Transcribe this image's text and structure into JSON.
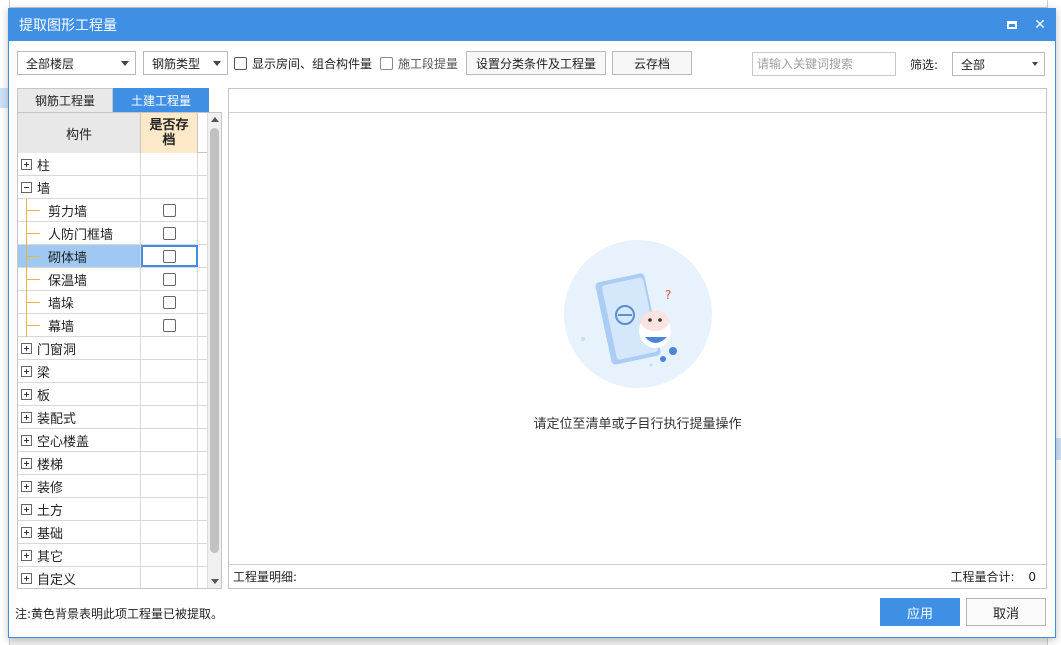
{
  "dialog": {
    "title": "提取图形工程量"
  },
  "toolbar": {
    "floor_select": "全部楼层",
    "rebar_type_select": "钢筋类型",
    "show_room_label": "显示房间、组合构件量",
    "construction_stage_label": "施工段提量",
    "settings_button": "设置分类条件及工程量",
    "cloud_archive_button": "云存档",
    "search_placeholder": "请输入关键词搜索",
    "filter_label": "筛选:",
    "filter_select": "全部"
  },
  "tabs": [
    {
      "label": "钢筋工程量",
      "active": false
    },
    {
      "label": "土建工程量",
      "active": true
    }
  ],
  "tree": {
    "header_name": "构件",
    "header_archive_1": "是否存",
    "header_archive_2": "档",
    "rows": [
      {
        "label": "柱",
        "type": "parent",
        "expanded": false
      },
      {
        "label": "墙",
        "type": "parent",
        "expanded": true
      },
      {
        "label": "剪力墙",
        "type": "child"
      },
      {
        "label": "人防门框墙",
        "type": "child"
      },
      {
        "label": "砌体墙",
        "type": "child",
        "selected": true
      },
      {
        "label": "保温墙",
        "type": "child"
      },
      {
        "label": "墙垛",
        "type": "child"
      },
      {
        "label": "幕墙",
        "type": "child"
      },
      {
        "label": "门窗洞",
        "type": "parent",
        "expanded": false
      },
      {
        "label": "梁",
        "type": "parent",
        "expanded": false
      },
      {
        "label": "板",
        "type": "parent",
        "expanded": false
      },
      {
        "label": "装配式",
        "type": "parent",
        "expanded": false
      },
      {
        "label": "空心楼盖",
        "type": "parent",
        "expanded": false
      },
      {
        "label": "楼梯",
        "type": "parent",
        "expanded": false
      },
      {
        "label": "装修",
        "type": "parent",
        "expanded": false
      },
      {
        "label": "土方",
        "type": "parent",
        "expanded": false
      },
      {
        "label": "基础",
        "type": "parent",
        "expanded": false
      },
      {
        "label": "其它",
        "type": "parent",
        "expanded": false
      },
      {
        "label": "自定义",
        "type": "parent",
        "expanded": false
      }
    ]
  },
  "main": {
    "empty_message": "请定位至清单或子目行执行提量操作",
    "footer_detail_label": "工程量明细:",
    "footer_total_label": "工程量合计:",
    "footer_total_value": "0"
  },
  "footer": {
    "note": "注:黄色背景表明此项工程量已被提取。",
    "apply_button": "应用",
    "cancel_button": "取消"
  },
  "colors": {
    "accent": "#3f8fe4",
    "archive_header": "#fde9c8",
    "selected_row": "#9fc9f3"
  }
}
